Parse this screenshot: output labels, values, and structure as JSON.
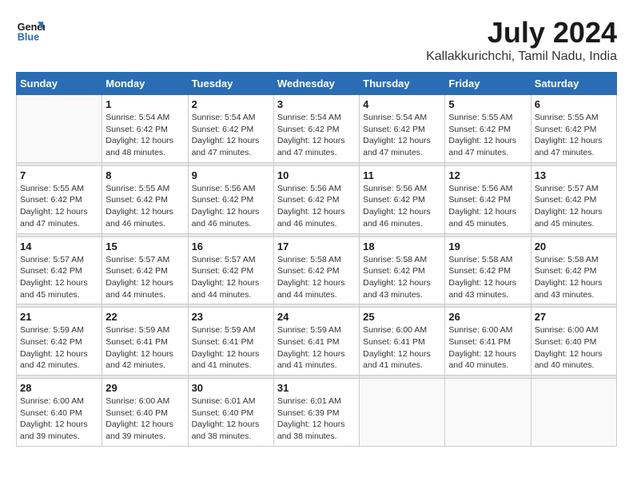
{
  "logo": {
    "line1": "General",
    "line2": "Blue"
  },
  "title": "July 2024",
  "subtitle": "Kallakkurichchi, Tamil Nadu, India",
  "weekdays": [
    "Sunday",
    "Monday",
    "Tuesday",
    "Wednesday",
    "Thursday",
    "Friday",
    "Saturday"
  ],
  "weeks": [
    [
      {
        "day": "",
        "info": ""
      },
      {
        "day": "1",
        "info": "Sunrise: 5:54 AM\nSunset: 6:42 PM\nDaylight: 12 hours\nand 48 minutes."
      },
      {
        "day": "2",
        "info": "Sunrise: 5:54 AM\nSunset: 6:42 PM\nDaylight: 12 hours\nand 47 minutes."
      },
      {
        "day": "3",
        "info": "Sunrise: 5:54 AM\nSunset: 6:42 PM\nDaylight: 12 hours\nand 47 minutes."
      },
      {
        "day": "4",
        "info": "Sunrise: 5:54 AM\nSunset: 6:42 PM\nDaylight: 12 hours\nand 47 minutes."
      },
      {
        "day": "5",
        "info": "Sunrise: 5:55 AM\nSunset: 6:42 PM\nDaylight: 12 hours\nand 47 minutes."
      },
      {
        "day": "6",
        "info": "Sunrise: 5:55 AM\nSunset: 6:42 PM\nDaylight: 12 hours\nand 47 minutes."
      }
    ],
    [
      {
        "day": "7",
        "info": "Sunrise: 5:55 AM\nSunset: 6:42 PM\nDaylight: 12 hours\nand 47 minutes."
      },
      {
        "day": "8",
        "info": "Sunrise: 5:55 AM\nSunset: 6:42 PM\nDaylight: 12 hours\nand 46 minutes."
      },
      {
        "day": "9",
        "info": "Sunrise: 5:56 AM\nSunset: 6:42 PM\nDaylight: 12 hours\nand 46 minutes."
      },
      {
        "day": "10",
        "info": "Sunrise: 5:56 AM\nSunset: 6:42 PM\nDaylight: 12 hours\nand 46 minutes."
      },
      {
        "day": "11",
        "info": "Sunrise: 5:56 AM\nSunset: 6:42 PM\nDaylight: 12 hours\nand 46 minutes."
      },
      {
        "day": "12",
        "info": "Sunrise: 5:56 AM\nSunset: 6:42 PM\nDaylight: 12 hours\nand 45 minutes."
      },
      {
        "day": "13",
        "info": "Sunrise: 5:57 AM\nSunset: 6:42 PM\nDaylight: 12 hours\nand 45 minutes."
      }
    ],
    [
      {
        "day": "14",
        "info": "Sunrise: 5:57 AM\nSunset: 6:42 PM\nDaylight: 12 hours\nand 45 minutes."
      },
      {
        "day": "15",
        "info": "Sunrise: 5:57 AM\nSunset: 6:42 PM\nDaylight: 12 hours\nand 44 minutes."
      },
      {
        "day": "16",
        "info": "Sunrise: 5:57 AM\nSunset: 6:42 PM\nDaylight: 12 hours\nand 44 minutes."
      },
      {
        "day": "17",
        "info": "Sunrise: 5:58 AM\nSunset: 6:42 PM\nDaylight: 12 hours\nand 44 minutes."
      },
      {
        "day": "18",
        "info": "Sunrise: 5:58 AM\nSunset: 6:42 PM\nDaylight: 12 hours\nand 43 minutes."
      },
      {
        "day": "19",
        "info": "Sunrise: 5:58 AM\nSunset: 6:42 PM\nDaylight: 12 hours\nand 43 minutes."
      },
      {
        "day": "20",
        "info": "Sunrise: 5:58 AM\nSunset: 6:42 PM\nDaylight: 12 hours\nand 43 minutes."
      }
    ],
    [
      {
        "day": "21",
        "info": "Sunrise: 5:59 AM\nSunset: 6:42 PM\nDaylight: 12 hours\nand 42 minutes."
      },
      {
        "day": "22",
        "info": "Sunrise: 5:59 AM\nSunset: 6:41 PM\nDaylight: 12 hours\nand 42 minutes."
      },
      {
        "day": "23",
        "info": "Sunrise: 5:59 AM\nSunset: 6:41 PM\nDaylight: 12 hours\nand 41 minutes."
      },
      {
        "day": "24",
        "info": "Sunrise: 5:59 AM\nSunset: 6:41 PM\nDaylight: 12 hours\nand 41 minutes."
      },
      {
        "day": "25",
        "info": "Sunrise: 6:00 AM\nSunset: 6:41 PM\nDaylight: 12 hours\nand 41 minutes."
      },
      {
        "day": "26",
        "info": "Sunrise: 6:00 AM\nSunset: 6:41 PM\nDaylight: 12 hours\nand 40 minutes."
      },
      {
        "day": "27",
        "info": "Sunrise: 6:00 AM\nSunset: 6:40 PM\nDaylight: 12 hours\nand 40 minutes."
      }
    ],
    [
      {
        "day": "28",
        "info": "Sunrise: 6:00 AM\nSunset: 6:40 PM\nDaylight: 12 hours\nand 39 minutes."
      },
      {
        "day": "29",
        "info": "Sunrise: 6:00 AM\nSunset: 6:40 PM\nDaylight: 12 hours\nand 39 minutes."
      },
      {
        "day": "30",
        "info": "Sunrise: 6:01 AM\nSunset: 6:40 PM\nDaylight: 12 hours\nand 38 minutes."
      },
      {
        "day": "31",
        "info": "Sunrise: 6:01 AM\nSunset: 6:39 PM\nDaylight: 12 hours\nand 38 minutes."
      },
      {
        "day": "",
        "info": ""
      },
      {
        "day": "",
        "info": ""
      },
      {
        "day": "",
        "info": ""
      }
    ]
  ]
}
